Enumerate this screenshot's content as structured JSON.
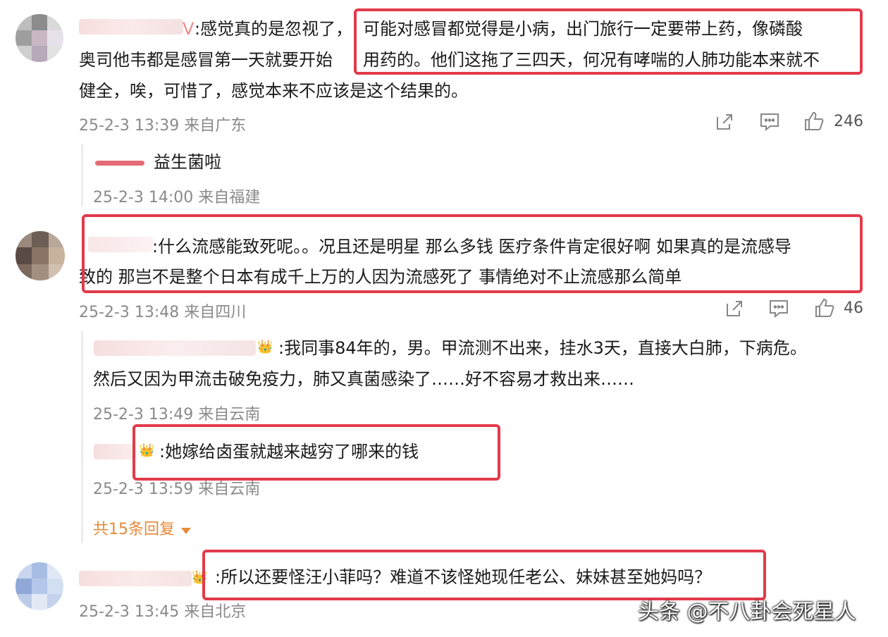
{
  "colors": {
    "highlight": "#e23a4a",
    "meta": "#8a8a8a",
    "more_replies": "#e58a3a"
  },
  "comments": [
    {
      "name_suffix": "V",
      "line1_pre": ":感觉真的是忽视了，",
      "line1_hl": "可能对感冒都觉得是小病，出门旅行一定要带上药，像磷酸",
      "line2_pre": "奥司他韦都是感冒第一天就要开始",
      "line2_hl": "用药的。他们这拖了三四天，何况有哮喘的人肺功能本来就不",
      "line3": "健全，唉，可惜了，感觉本来不应该是这个结果的。",
      "meta": "25-2-3 13:39 来自广东",
      "likes": "246"
    },
    {
      "reply_text": "益生菌啦",
      "meta": "25-2-3 14:00 来自福建"
    },
    {
      "line1": ":什么流感能致死呢。。况且还是明星 那么多钱 医疗条件肯定很好啊 如果真的是流感导",
      "line2": "致的 那岂不是整个日本有成千上万的人因为流感死了 事情绝对不止流感那么简单",
      "meta": "25-2-3 13:48 来自四川",
      "likes": "46"
    },
    {
      "line1": ":我同事84年的，男。甲流测不出来，挂水3天，直接大白肺，下病危。",
      "line2": "然后又因为甲流击破免疫力，肺又真菌感染了……好不容易才救出来……",
      "meta": "25-2-3 13:49 来自云南"
    },
    {
      "line1": ":她嫁给卤蛋就越来越穷了哪来的钱",
      "meta": "25-2-3 13:59 来自云南"
    },
    {
      "more_replies": "共15条回复"
    },
    {
      "line1": ":所以还要怪汪小菲吗？难道不该怪她现任老公、妹妹甚至她妈吗？",
      "meta": "25-2-3 13:45 来自北京"
    }
  ],
  "watermark": "头条 @不八卦会死星人"
}
